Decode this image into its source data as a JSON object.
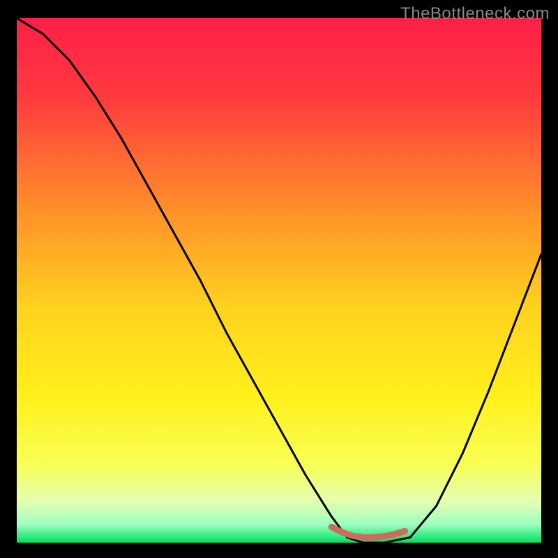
{
  "watermark": "TheBottleneck.com",
  "colors": {
    "gradient_stops": [
      {
        "offset": 0.0,
        "color": "#ff1f47"
      },
      {
        "offset": 0.15,
        "color": "#ff3a3f"
      },
      {
        "offset": 0.35,
        "color": "#ff8a2a"
      },
      {
        "offset": 0.55,
        "color": "#ffd21f"
      },
      {
        "offset": 0.72,
        "color": "#fff01a"
      },
      {
        "offset": 0.85,
        "color": "#f8ff55"
      },
      {
        "offset": 0.92,
        "color": "#e5ffb0"
      },
      {
        "offset": 0.965,
        "color": "#9effc0"
      },
      {
        "offset": 1.0,
        "color": "#00e060"
      }
    ],
    "curve": "#000000",
    "marker": "#cc6b5e",
    "frame": "#000000"
  },
  "chart_data": {
    "type": "line",
    "title": "",
    "xlabel": "",
    "ylabel": "",
    "xlim": [
      0,
      100
    ],
    "ylim": [
      0,
      100
    ],
    "series": [
      {
        "name": "bottleneck-curve",
        "x": [
          0,
          5,
          10,
          15,
          20,
          25,
          30,
          35,
          40,
          45,
          50,
          55,
          60,
          63,
          66,
          70,
          75,
          80,
          85,
          90,
          95,
          100
        ],
        "values": [
          100,
          97,
          92,
          85,
          77,
          68,
          59,
          50,
          40,
          31,
          22,
          13,
          5,
          1,
          0,
          0,
          1,
          7,
          17,
          29,
          42,
          55
        ]
      }
    ],
    "markers": {
      "name": "optimal-range",
      "x": [
        60,
        62,
        64,
        66,
        68,
        70,
        72,
        74
      ],
      "values": [
        3,
        2,
        1.3,
        1,
        1,
        1.2,
        1.6,
        2.2
      ]
    }
  }
}
